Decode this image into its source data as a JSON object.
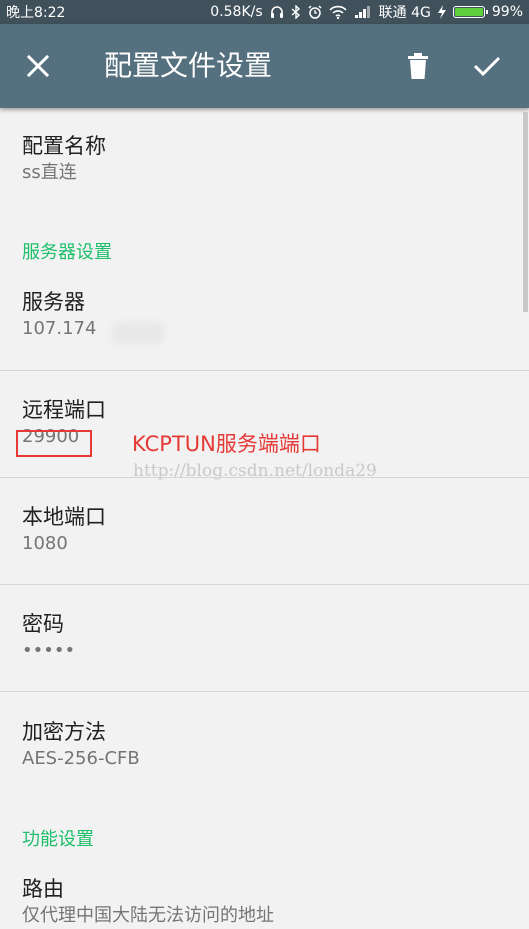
{
  "status_bar": {
    "time": "晚上8:22",
    "speed": "0.58K/s",
    "carrier": "联通 4G",
    "battery": "99%",
    "battery_level": 0.99,
    "icons": [
      "headphones-icon",
      "bluetooth-icon",
      "alarm-icon",
      "wifi-icon",
      "signal-icon",
      "charging-icon",
      "battery-icon"
    ]
  },
  "toolbar": {
    "title": "配置文件设置",
    "icons": [
      "close-icon",
      "trash-icon",
      "check-icon"
    ]
  },
  "profile": {
    "name_label": "配置名称",
    "name_value": "ss直连"
  },
  "server_settings": {
    "header": "服务器设置",
    "server_label": "服务器",
    "server_value": "107.174",
    "remote_port_label": "远程端口",
    "remote_port_value": "29900",
    "local_port_label": "本地端口",
    "local_port_value": "1080",
    "password_label": "密码",
    "password_value": "•••••",
    "encryption_label": "加密方法",
    "encryption_value": "AES-256-CFB"
  },
  "feature_settings": {
    "header": "功能设置",
    "route_label": "路由",
    "route_value": "仅代理中国大陆无法访问的地址"
  },
  "annotation": {
    "text": "KCPTUN服务端端口",
    "color": "#e53935"
  },
  "watermark": "http://blog.csdn.net/londa29",
  "colors": {
    "toolbar": "#55707e",
    "status_bar": "#40515b",
    "section_header": "#1dbf6b"
  }
}
